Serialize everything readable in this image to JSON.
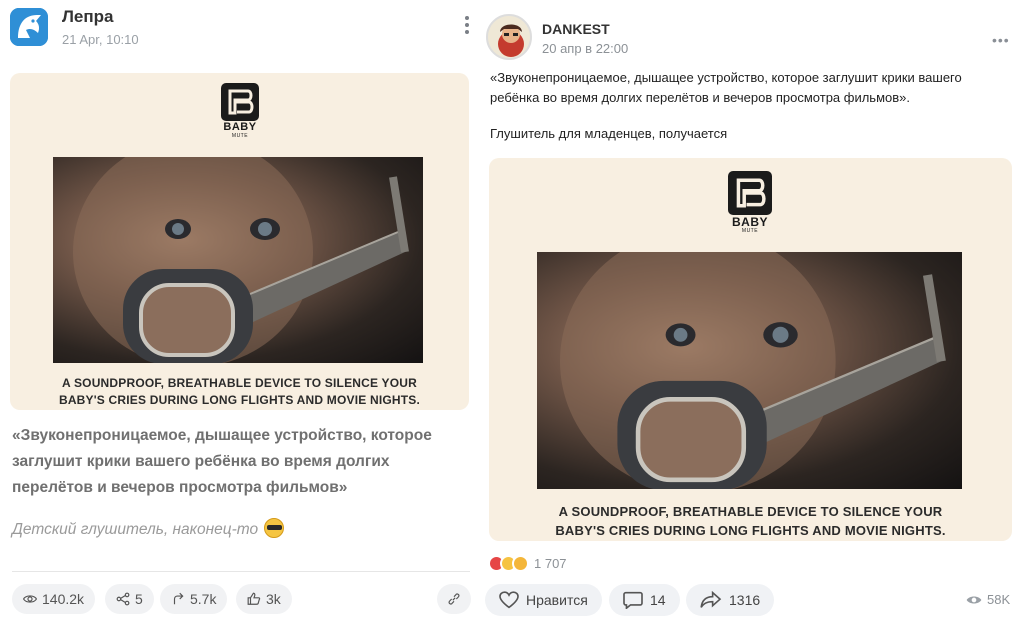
{
  "left_post": {
    "author": "Лепра",
    "date": "21 Apr, 10:10",
    "image": {
      "logo_text": "BABY",
      "logo_sub": "MUTE",
      "caption_line1": "A SOUNDPROOF, BREATHABLE DEVICE TO SILENCE YOUR",
      "caption_line2": "BABY'S CRIES DURING LONG FLIGHTS AND MOVIE NIGHTS."
    },
    "text_main": "«Звуконепроницаемое, дышащее устройство, которое заглушит крики вашего ребёнка во время долгих перелётов и вечеров просмотра фильмов»",
    "text_secondary": "Детский глушитель, наконец-то",
    "stats": {
      "views": "140.2k",
      "shares_alt": "5",
      "reposts": "5.7k",
      "likes": "3k"
    }
  },
  "right_post": {
    "author": "DANKEST",
    "date": "20 апр в 22:00",
    "text_main": "«Звуконепроницаемое, дышащее устройство, которое заглушит крики вашего ребёнка во время долгих перелётов и вечеров просмотра фильмов».",
    "text_secondary": "Глушитель для младенцев, получается",
    "image": {
      "logo_text": "BABY",
      "logo_sub": "MUTE",
      "caption_line1": "A SOUNDPROOF, BREATHABLE DEVICE TO SILENCE YOUR",
      "caption_line2": "BABY'S CRIES DURING LONG FLIGHTS AND MOVIE NIGHTS."
    },
    "reactions_count": "1 707",
    "like_label": "Нравится",
    "comments": "14",
    "shares": "1316",
    "views": "58K"
  },
  "colors": {
    "card_bg": "#f8efe1",
    "pill_bg": "#f1f2f4",
    "muted_text": "#8c9196"
  }
}
